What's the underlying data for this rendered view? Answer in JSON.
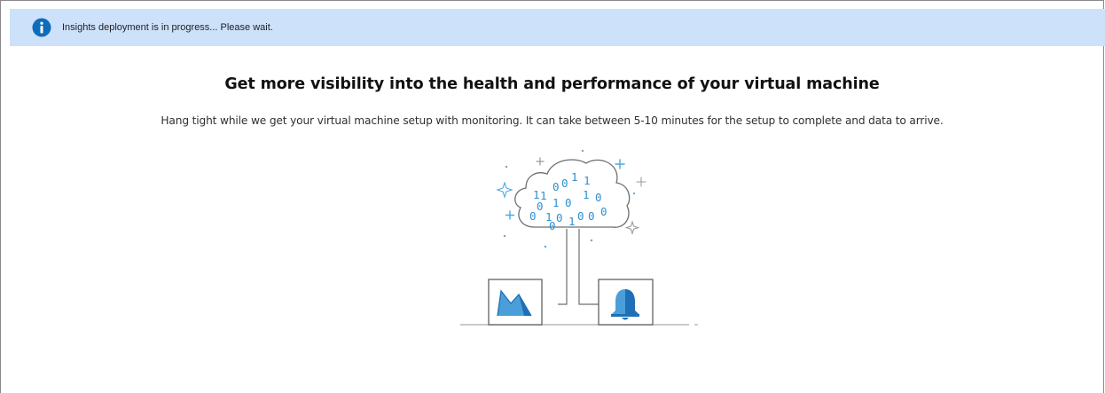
{
  "banner": {
    "icon": "info-icon",
    "text": "Insights deployment is in progress... Please wait.",
    "background": "#cde1fb",
    "icon_color": "#0f6cbd"
  },
  "main": {
    "headline": "Get more visibility into the health and performance of your virtual machine",
    "subtext": "Hang tight while we get your virtual machine setup with monitoring. It can take between 5-10 minutes for the setup to complete and data to arrive."
  },
  "illustration": {
    "cloud_digits": [
      "1",
      "1",
      "0",
      "0",
      "1",
      "1",
      "0",
      "1",
      "0",
      "1",
      "0",
      "0",
      "1",
      "0",
      "0",
      "0",
      "1",
      "0",
      "0"
    ],
    "left_box_icon": "area-chart-icon",
    "right_box_icon": "bell-icon",
    "accent_color": "#5aacdc",
    "dark_accent_color": "#1e6fb6"
  }
}
